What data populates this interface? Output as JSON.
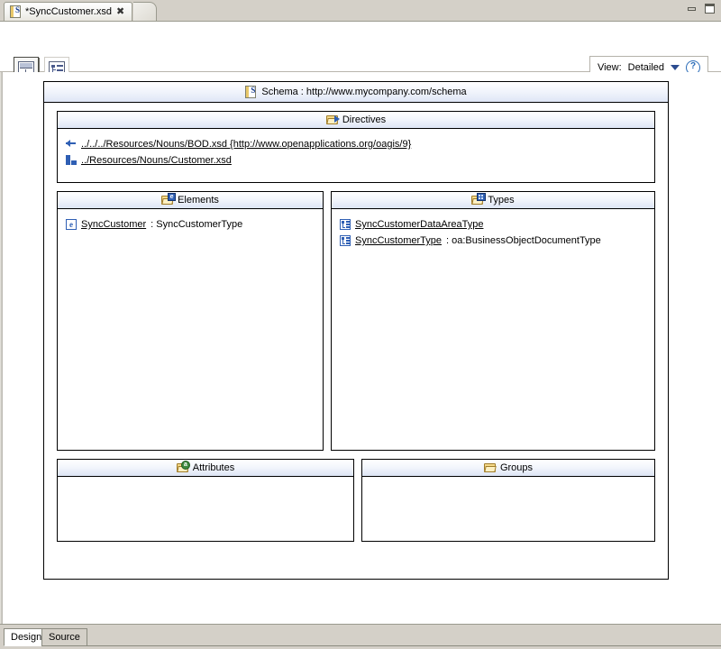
{
  "window": {
    "minimize_label": "minimize",
    "maximize_label": "maximize"
  },
  "editor_tab": {
    "icon": "schema-file-icon",
    "title": "*SyncCustomer.xsd",
    "close_label": "✖"
  },
  "toolbar": {
    "buttons": [
      {
        "name": "schema-overview-view-button",
        "icon": "overview-icon",
        "pressed": true
      },
      {
        "name": "outline-tree-view-button",
        "icon": "tree-icon",
        "pressed": false
      }
    ],
    "view_label": "View:",
    "view_value": "Detailed",
    "dropdown_icon": "chevron-down-icon",
    "help_icon": "help-icon",
    "help_glyph": "?"
  },
  "schema": {
    "icon": "schema-file-icon",
    "title": "Schema : http://www.mycompany.com/schema"
  },
  "sections": {
    "directives": {
      "icon": "directives-folder-icon",
      "title": "Directives",
      "rows": [
        {
          "icon": "import-directive-icon",
          "link": "../../../Resources/Nouns/BOD.xsd  {http://www.openapplications.org/oagis/9}",
          "suffix": ""
        },
        {
          "icon": "include-directive-icon",
          "link": "../Resources/Nouns/Customer.xsd",
          "suffix": ""
        }
      ]
    },
    "elements": {
      "icon": "elements-folder-icon",
      "badge_glyph": "e",
      "title": "Elements",
      "rows": [
        {
          "icon": "element-icon",
          "link": "SyncCustomer",
          "suffix": ": SyncCustomerType"
        }
      ]
    },
    "types": {
      "icon": "types-folder-icon",
      "title": "Types",
      "rows": [
        {
          "icon": "complex-type-icon",
          "link": "SyncCustomerDataAreaType",
          "suffix": ""
        },
        {
          "icon": "complex-type-icon",
          "link": "SyncCustomerType",
          "suffix": ": oa:BusinessObjectDocumentType"
        }
      ]
    },
    "attributes": {
      "icon": "attributes-folder-icon",
      "badge_glyph": "a",
      "title": "Attributes",
      "rows": []
    },
    "groups": {
      "icon": "groups-folder-icon",
      "title": "Groups",
      "rows": []
    }
  },
  "bottom_tabs": {
    "design": "Design",
    "source": "Source"
  },
  "colors": {
    "accent_blue": "#2f5fb4",
    "header_gradient_end": "#dde5f5",
    "chrome": "#d4d0c8",
    "folder_yellow": "#f5d98a"
  }
}
